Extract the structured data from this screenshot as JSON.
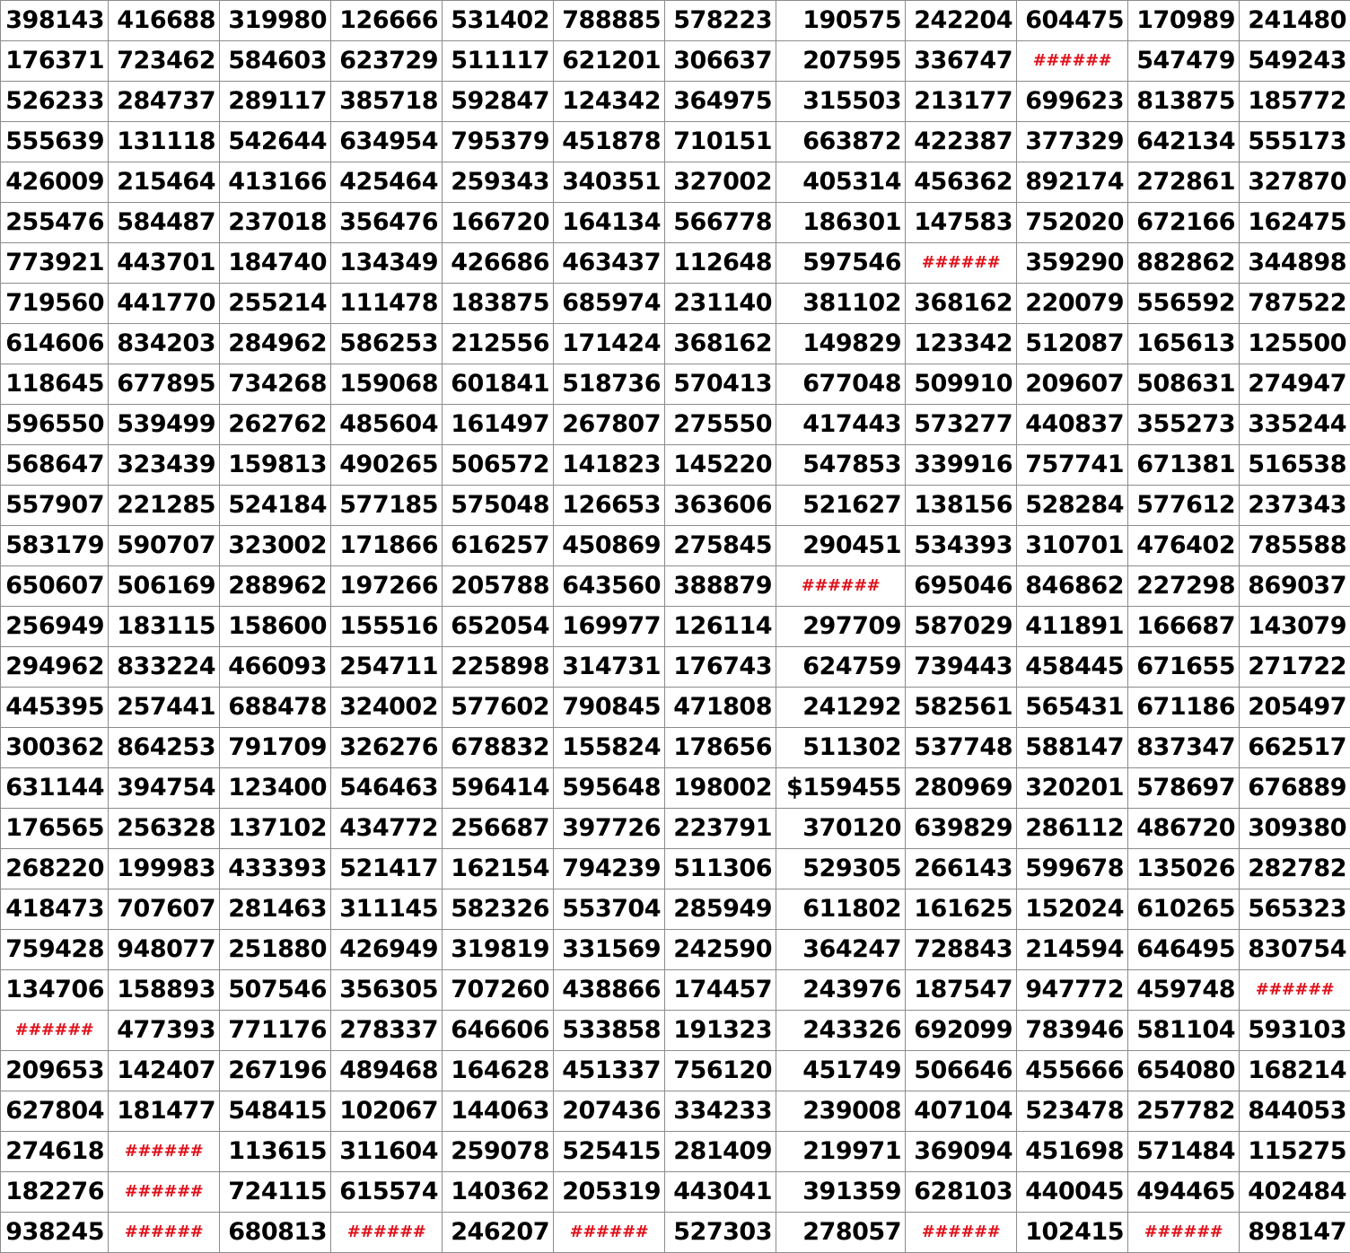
{
  "colors": {
    "text": "#000000",
    "error": "#e0101a",
    "grid": "#8c8c8c",
    "background": "#ffffff"
  },
  "rows": [
    [
      "398143",
      "416688",
      "319980",
      "126666",
      "531402",
      "788885",
      "578223",
      "190575",
      "242204",
      "604475",
      "170989",
      "241480"
    ],
    [
      "176371",
      "723462",
      "584603",
      "623729",
      "511117",
      "621201",
      "306637",
      "207595",
      "336747",
      "######",
      "547479",
      "549243"
    ],
    [
      "526233",
      "284737",
      "289117",
      "385718",
      "592847",
      "124342",
      "364975",
      "315503",
      "213177",
      "699623",
      "813875",
      "185772"
    ],
    [
      "555639",
      "131118",
      "542644",
      "634954",
      "795379",
      "451878",
      "710151",
      "663872",
      "422387",
      "377329",
      "642134",
      "555173"
    ],
    [
      "426009",
      "215464",
      "413166",
      "425464",
      "259343",
      "340351",
      "327002",
      "405314",
      "456362",
      "892174",
      "272861",
      "327870"
    ],
    [
      "255476",
      "584487",
      "237018",
      "356476",
      "166720",
      "164134",
      "566778",
      "186301",
      "147583",
      "752020",
      "672166",
      "162475"
    ],
    [
      "773921",
      "443701",
      "184740",
      "134349",
      "426686",
      "463437",
      "112648",
      "597546",
      "######",
      "359290",
      "882862",
      "344898"
    ],
    [
      "719560",
      "441770",
      "255214",
      "111478",
      "183875",
      "685974",
      "231140",
      "381102",
      "368162",
      "220079",
      "556592",
      "787522"
    ],
    [
      "614606",
      "834203",
      "284962",
      "586253",
      "212556",
      "171424",
      "368162",
      "149829",
      "123342",
      "512087",
      "165613",
      "125500"
    ],
    [
      "118645",
      "677895",
      "734268",
      "159068",
      "601841",
      "518736",
      "570413",
      "677048",
      "509910",
      "209607",
      "508631",
      "274947"
    ],
    [
      "596550",
      "539499",
      "262762",
      "485604",
      "161497",
      "267807",
      "275550",
      "417443",
      "573277",
      "440837",
      "355273",
      "335244"
    ],
    [
      "568647",
      "323439",
      "159813",
      "490265",
      "506572",
      "141823",
      "145220",
      "547853",
      "339916",
      "757741",
      "671381",
      "516538"
    ],
    [
      "557907",
      "221285",
      "524184",
      "577185",
      "575048",
      "126653",
      "363606",
      "521627",
      "138156",
      "528284",
      "577612",
      "237343"
    ],
    [
      "583179",
      "590707",
      "323002",
      "171866",
      "616257",
      "450869",
      "275845",
      "290451",
      "534393",
      "310701",
      "476402",
      "785588"
    ],
    [
      "650607",
      "506169",
      "288962",
      "197266",
      "205788",
      "643560",
      "388879",
      "######",
      "695046",
      "846862",
      "227298",
      "869037"
    ],
    [
      "256949",
      "183115",
      "158600",
      "155516",
      "652054",
      "169977",
      "126114",
      "297709",
      "587029",
      "411891",
      "166687",
      "143079"
    ],
    [
      "294962",
      "833224",
      "466093",
      "254711",
      "225898",
      "314731",
      "176743",
      "624759",
      "739443",
      "458445",
      "671655",
      "271722"
    ],
    [
      "445395",
      "257441",
      "688478",
      "324002",
      "577602",
      "790845",
      "471808",
      "241292",
      "582561",
      "565431",
      "671186",
      "205497"
    ],
    [
      "300362",
      "864253",
      "791709",
      "326276",
      "678832",
      "155824",
      "178656",
      "511302",
      "537748",
      "588147",
      "837347",
      "662517"
    ],
    [
      "631144",
      "394754",
      "123400",
      "546463",
      "596414",
      "595648",
      "198002",
      "$159455",
      "280969",
      "320201",
      "578697",
      "676889"
    ],
    [
      "176565",
      "256328",
      "137102",
      "434772",
      "256687",
      "397726",
      "223791",
      "370120",
      "639829",
      "286112",
      "486720",
      "309380"
    ],
    [
      "268220",
      "199983",
      "433393",
      "521417",
      "162154",
      "794239",
      "511306",
      "529305",
      "266143",
      "599678",
      "135026",
      "282782"
    ],
    [
      "418473",
      "707607",
      "281463",
      "311145",
      "582326",
      "553704",
      "285949",
      "611802",
      "161625",
      "152024",
      "610265",
      "565323"
    ],
    [
      "759428",
      "948077",
      "251880",
      "426949",
      "319819",
      "331569",
      "242590",
      "364247",
      "728843",
      "214594",
      "646495",
      "830754"
    ],
    [
      "134706",
      "158893",
      "507546",
      "356305",
      "707260",
      "438866",
      "174457",
      "243976",
      "187547",
      "947772",
      "459748",
      "######"
    ],
    [
      "######",
      "477393",
      "771176",
      "278337",
      "646606",
      "533858",
      "191323",
      "243326",
      "692099",
      "783946",
      "581104",
      "593103"
    ],
    [
      "209653",
      "142407",
      "267196",
      "489468",
      "164628",
      "451337",
      "756120",
      "451749",
      "506646",
      "455666",
      "654080",
      "168214"
    ],
    [
      "627804",
      "181477",
      "548415",
      "102067",
      "144063",
      "207436",
      "334233",
      "239008",
      "407104",
      "523478",
      "257782",
      "844053"
    ],
    [
      "274618",
      "######",
      "113615",
      "311604",
      "259078",
      "525415",
      "281409",
      "219971",
      "369094",
      "451698",
      "571484",
      "115275"
    ],
    [
      "182276",
      "######",
      "724115",
      "615574",
      "140362",
      "205319",
      "443041",
      "391359",
      "628103",
      "440045",
      "494465",
      "402484"
    ],
    [
      "938245",
      "######",
      "680813",
      "######",
      "246207",
      "######",
      "527303",
      "278057",
      "######",
      "102415",
      "######",
      "898147"
    ]
  ]
}
